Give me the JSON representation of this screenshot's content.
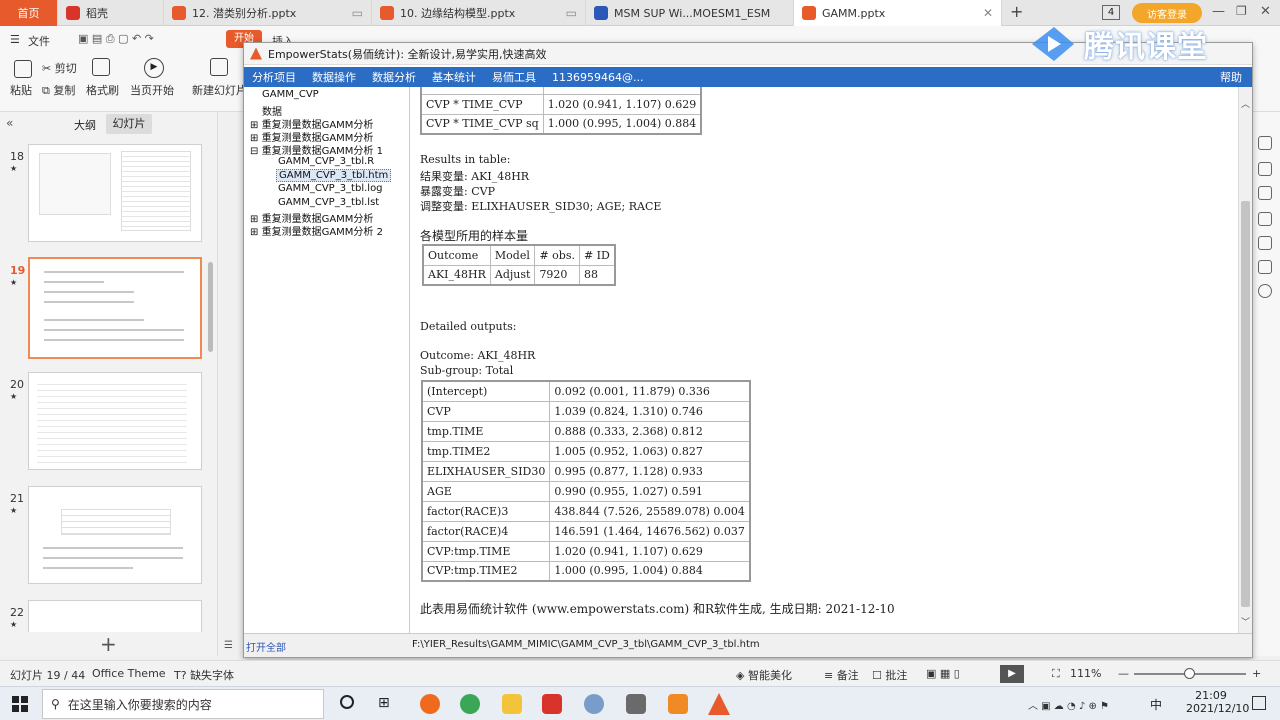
{
  "tabs": [
    {
      "label": "首页",
      "color": "#e65a2b"
    },
    {
      "label": "稻壳",
      "color": "#d9342b"
    },
    {
      "label": "12. 潜类别分析.pptx",
      "color": "#e65a2b"
    },
    {
      "label": "10. 边缘结构模型.pptx",
      "color": "#e65a2b"
    },
    {
      "label": "MSM SUP Wi...MOESM1_ESM",
      "color": "#2b57b8"
    },
    {
      "label": "GAMM.pptx",
      "color": "#e65a2b"
    }
  ],
  "tab_badge": "4",
  "guest_label": "访客登录",
  "watermark": {
    "text": "腾讯课堂"
  },
  "ribbon": {
    "file_menu": "文件",
    "start_tab": "开始",
    "tab_partial": "插入",
    "cut": "剪切",
    "copy": "复制",
    "paste": "粘贴",
    "format_painter": "格式刷",
    "from_current": "当页开始",
    "new_slide": "新建幻灯片"
  },
  "slide_panel": {
    "outline_tab": "大纲",
    "slides_tab": "幻灯片",
    "slides": [
      {
        "num": "18",
        "selected": false
      },
      {
        "num": "19",
        "selected": true
      },
      {
        "num": "20",
        "selected": false
      },
      {
        "num": "21",
        "selected": false
      },
      {
        "num": "22",
        "selected": false
      }
    ],
    "star": "★",
    "add": "+"
  },
  "empower": {
    "title": "EmpowerStats(易侕统计): 全新设计,易学实用,快速高效",
    "menu": [
      "分析项目",
      "数据操作",
      "数据分析",
      "基本统计",
      "易侕工具",
      "1136959464@..."
    ],
    "help": "帮助",
    "tree": [
      {
        "label": "GAMM_CVP",
        "indent": 0,
        "expander": ""
      },
      {
        "label": "数据",
        "indent": 0,
        "expander": ""
      },
      {
        "label": "重复测量数据GAMM分析",
        "indent": 0,
        "expander": "⊞"
      },
      {
        "label": "重复测量数据GAMM分析",
        "indent": 0,
        "expander": "⊞"
      },
      {
        "label": "重复测量数据GAMM分析 1",
        "indent": 0,
        "expander": "⊟"
      },
      {
        "label": "GAMM_CVP_3_tbl.R",
        "indent": 1,
        "expander": ""
      },
      {
        "label": "GAMM_CVP_3_tbl.htm",
        "indent": 1,
        "expander": "",
        "selected": true
      },
      {
        "label": "GAMM_CVP_3_tbl.log",
        "indent": 1,
        "expander": ""
      },
      {
        "label": "GAMM_CVP_3_tbl.lst",
        "indent": 1,
        "expander": ""
      },
      {
        "label": "重复测量数据GAMM分析",
        "indent": 0,
        "expander": "⊞"
      },
      {
        "label": "重复测量数据GAMM分析 2",
        "indent": 0,
        "expander": "⊞"
      }
    ],
    "open_all": "打开全部",
    "filepath": "F:\\YIER_Results\\GAMM_MIMIC\\GAMM_CVP_3_tbl\\GAMM_CVP_3_tbl.htm",
    "top_table": [
      [
        "CVP * TIME_CVP",
        "1.020 (0.941, 1.107) 0.629"
      ],
      [
        "CVP * TIME_CVP sq",
        "1.000 (0.995, 1.004) 0.884"
      ]
    ],
    "results_lines": [
      "Results in table:",
      "结果变量: AKI_48HR",
      "暴露变量: CVP",
      "调整变量: ELIXHAUSER_SID30; AGE; RACE"
    ],
    "sample_title": "各模型所用的样本量",
    "sample_header": [
      "Outcome",
      "Model",
      "# obs.",
      "# ID"
    ],
    "sample_row": [
      "AKI_48HR",
      "Adjust",
      "7920",
      "88"
    ],
    "detailed_label": "Detailed outputs:",
    "outcome_line": "Outcome: AKI_48HR",
    "subgroup_line": "Sub-group: Total",
    "detail_rows": [
      [
        "(Intercept)",
        "0.092 (0.001, 11.879) 0.336"
      ],
      [
        "CVP",
        "1.039 (0.824, 1.310) 0.746"
      ],
      [
        "tmp.TIME",
        "0.888 (0.333, 2.368) 0.812"
      ],
      [
        "tmp.TIME2",
        "1.005 (0.952, 1.063) 0.827"
      ],
      [
        "ELIXHAUSER_SID30",
        "0.995 (0.877, 1.128) 0.933"
      ],
      [
        "AGE",
        "0.990 (0.955, 1.027) 0.591"
      ],
      [
        "factor(RACE)3",
        "438.844 (7.526, 25589.078) 0.004"
      ],
      [
        "factor(RACE)4",
        "146.591 (1.464, 14676.562) 0.037"
      ],
      [
        "CVP:tmp.TIME",
        "1.020 (0.941, 1.107) 0.629"
      ],
      [
        "CVP:tmp.TIME2",
        "1.000 (0.995, 1.004) 0.884"
      ]
    ],
    "footer": "此表用易侕统计软件 (www.empowerstats.com) 和R软件生成, 生成日期:  2021-12-10"
  },
  "ppt_status": {
    "slide_count": "幻灯片 19 / 44",
    "theme": "Office Theme",
    "missing_font": "缺失字体",
    "beautify": "智能美化",
    "notes": "备注",
    "comment": "批注",
    "zoom": "111%"
  },
  "taskbar": {
    "search_placeholder": "在这里输入你要搜索的内容",
    "time": "21:09",
    "date": "2021/12/10",
    "ime": "中"
  }
}
